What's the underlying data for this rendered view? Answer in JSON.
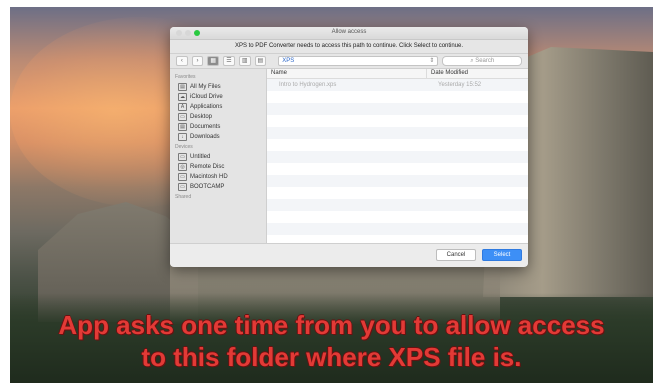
{
  "dialog": {
    "title": "Allow access",
    "message": "XPS to PDF Converter needs to access this path to continue. Click Select to continue.",
    "toolbar": {
      "back": "‹",
      "forward": "›",
      "view_icons": [
        "▦",
        "☰",
        "▥",
        "▤"
      ],
      "location": "XPS",
      "search_placeholder": "Search"
    },
    "sidebar": {
      "favorites_label": "Favorites",
      "favorites": [
        {
          "label": "All My Files",
          "icon": "▤"
        },
        {
          "label": "iCloud Drive",
          "icon": "☁"
        },
        {
          "label": "Applications",
          "icon": "A"
        },
        {
          "label": "Desktop",
          "icon": "▭"
        },
        {
          "label": "Documents",
          "icon": "▤"
        },
        {
          "label": "Downloads",
          "icon": "↓"
        }
      ],
      "devices_label": "Devices",
      "devices": [
        {
          "label": "Untitled",
          "icon": "▭"
        },
        {
          "label": "Remote Disc",
          "icon": "◎"
        },
        {
          "label": "Macintosh HD",
          "icon": "▭"
        },
        {
          "label": "BOOTCAMP",
          "icon": "▭"
        }
      ],
      "shared_label": "Shared"
    },
    "columns": {
      "name": "Name",
      "date": "Date Modified"
    },
    "files": [
      {
        "name": "Intro to Hydrogen.xps",
        "date": "Yesterday 15:52"
      }
    ],
    "buttons": {
      "cancel": "Cancel",
      "open": "Select"
    }
  },
  "caption": {
    "line1": "App asks one time from you to allow access",
    "line2": "to this folder where XPS file is."
  },
  "colors": {
    "caption_red": "#e23a36",
    "accent_blue": "#3d8ff6"
  }
}
